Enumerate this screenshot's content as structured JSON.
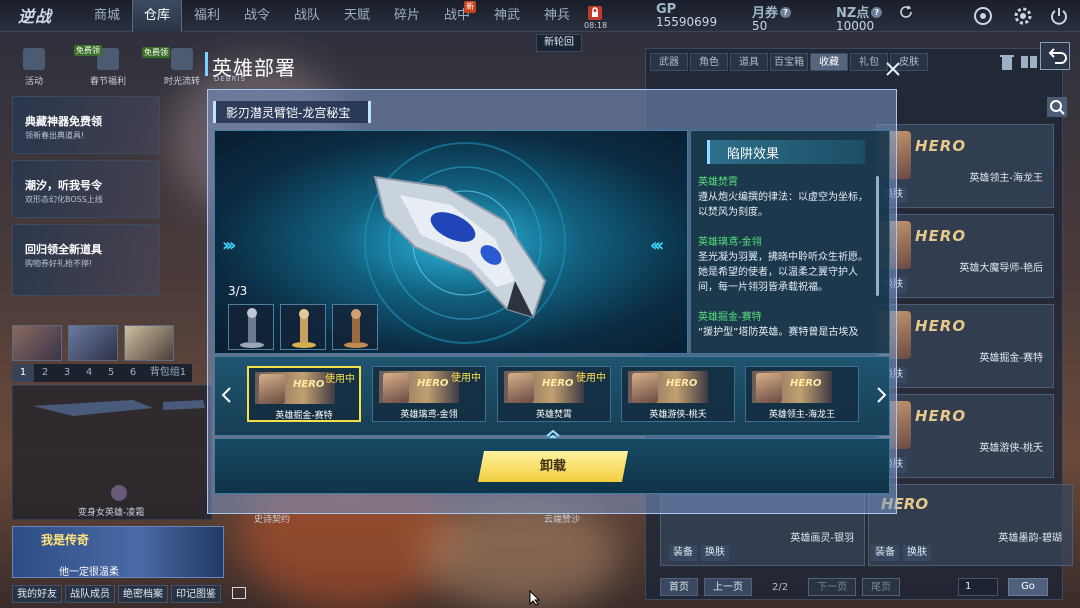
{
  "top_nav": {
    "logo": "逆战",
    "items": [
      {
        "label": "商城",
        "badge": ""
      },
      {
        "label": "仓库",
        "badge": ""
      },
      {
        "label": "福利",
        "badge": ""
      },
      {
        "label": "战令",
        "badge": ""
      },
      {
        "label": "战队",
        "badge": ""
      },
      {
        "label": "天赋",
        "badge": ""
      },
      {
        "label": "碎片",
        "badge": ""
      },
      {
        "label": "战中",
        "badge": "新"
      },
      {
        "label": "神武",
        "badge": ""
      },
      {
        "label": "神兵",
        "badge": ""
      }
    ],
    "active_index": 1,
    "lock_time": "08:18",
    "tooltip": "新轮回",
    "currencies": [
      {
        "label": "GP",
        "value": "15590699"
      },
      {
        "label": "月券",
        "value": "50"
      },
      {
        "label": "NZ点",
        "value": "10000"
      }
    ]
  },
  "left": {
    "activities": [
      {
        "label": "活动",
        "tag": ""
      },
      {
        "label": "春节福利",
        "tag": "免费领"
      },
      {
        "label": "时光流转",
        "tag": "免费领"
      }
    ],
    "promos": [
      {
        "title": "典藏神器免费领",
        "sub": "领新春出典道具!"
      },
      {
        "title": "潮汐，听我号令",
        "sub": "双形态幻化BOSS上线"
      },
      {
        "title": "回归领全新道具",
        "sub": "购物券好礼抢不停!"
      }
    ],
    "tabs": [
      "1",
      "2",
      "3",
      "4",
      "5",
      "6",
      "背包组1"
    ],
    "weapon_name": "变身女英雄-凌霜",
    "banner": {
      "title": "我是传奇",
      "sub": "他一定很温柔"
    },
    "bottom_buttons": [
      "我的好友",
      "战队成员",
      "绝密档案",
      "印记图鉴"
    ]
  },
  "bg_labels": {
    "mid1": "史诗契约",
    "mid2": "云端赞沙",
    "side": "逆战"
  },
  "right": {
    "tabs": [
      "武器",
      "角色",
      "道具",
      "百宝箱",
      "收藏",
      "礼包",
      "皮肤"
    ],
    "active_tab": 4,
    "cards": [
      {
        "hero": "HERO",
        "name": "英雄领主-海龙王",
        "btn": "换肤"
      },
      {
        "hero": "HERO",
        "name": "英雄大魔导师-艳后",
        "btn": "换肤"
      },
      {
        "hero": "HERO",
        "name": "英雄掘金-赛特",
        "btn": "换肤"
      },
      {
        "hero": "HERO",
        "name": "英雄游侠-桃夭",
        "btn": "换肤"
      }
    ],
    "bottom_cards": [
      {
        "name": "英雄画灵-银羽",
        "btn1": "装备",
        "btn2": "换肤"
      },
      {
        "name": "英雄墨韵-碧瑚",
        "btn1": "装备",
        "btn2": "换肤"
      }
    ],
    "pager": {
      "first": "首页",
      "prev": "上一页",
      "info": "2/2",
      "next": "下一页",
      "last": "尾页",
      "page_value": "1",
      "go": "Go"
    }
  },
  "modal": {
    "title": "英雄部署",
    "subtitle": "DEBRIS",
    "item_title": "影刃潜灵臂铠-龙宫秘宝",
    "count": "3/3",
    "effect_head": "陷阱效果",
    "effects": [
      {
        "name": "英雄焚霄",
        "desc": "遵从炮火编撰的律法：以虚空为坐标，以焚风为刻度。"
      },
      {
        "name": "英雄璃鸢-金翎",
        "desc": "圣光凝为羽翼，拂晓中聆听众生祈愿。她是希望的使者，以温柔之翼守护人间，每一片翎羽皆承载祝福。"
      },
      {
        "name": "英雄掘金-赛特",
        "desc": "“援护型”塔防英雄。赛特曾是古埃及"
      }
    ],
    "heroes": [
      {
        "name": "英雄掘金-赛特",
        "using": "使用中",
        "hero": "HERO",
        "selected": true
      },
      {
        "name": "英雄璃鸢-金翎",
        "using": "使用中",
        "hero": "HERO",
        "selected": false
      },
      {
        "name": "英雄焚霄",
        "using": "使用中",
        "hero": "HERO",
        "selected": false
      },
      {
        "name": "英雄游侠-桃夭",
        "using": "",
        "hero": "HERO",
        "selected": false
      },
      {
        "name": "英雄领主-海龙王",
        "using": "",
        "hero": "HERO",
        "selected": false
      }
    ],
    "action_label": "卸载"
  },
  "colors": {
    "accent": "#40d6ff",
    "using": "#ffe04a",
    "effect_name": "#56e17a",
    "button_gold": "#f3cf3f"
  }
}
